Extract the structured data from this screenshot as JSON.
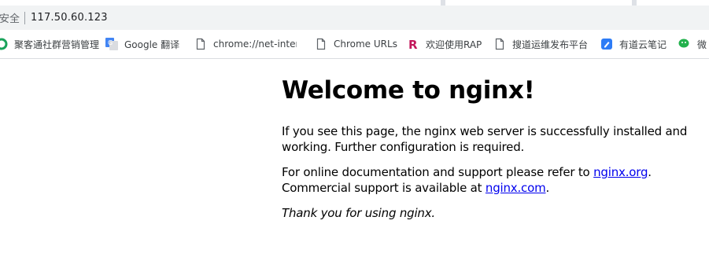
{
  "browser": {
    "security_label": "安全",
    "url": "117.50.60.123",
    "bookmarks": [
      {
        "label": "聚客通社群营销管理",
        "icon": "green-ring-icon"
      },
      {
        "label": "Google 翻译",
        "icon": "google-translate-icon"
      },
      {
        "label": "chrome://net-intern",
        "icon": "page-icon"
      },
      {
        "label": "Chrome URLs",
        "icon": "page-icon"
      },
      {
        "label": "欢迎使用RAP",
        "icon": "rap-r-icon"
      },
      {
        "label": "搜道运维发布平台",
        "icon": "page-icon"
      },
      {
        "label": "有道云笔记",
        "icon": "youdao-note-icon"
      },
      {
        "label": "微",
        "icon": "wechat-icon"
      }
    ]
  },
  "page": {
    "title": "Welcome to nginx!",
    "para1": "If you see this page, the nginx web server is successfully installed and working. Further configuration is required.",
    "para2_prefix": "For online documentation and support please refer to ",
    "link_org": "nginx.org",
    "para2_mid": ".",
    "para2_line2_prefix": "Commercial support is available at ",
    "link_com": "nginx.com",
    "para2_end": ".",
    "thanks": "Thank you for using nginx."
  },
  "colors": {
    "link": "#0000ee",
    "toolbar_bg": "#f1f3f4",
    "tabstrip_bg": "#dee1e6"
  }
}
